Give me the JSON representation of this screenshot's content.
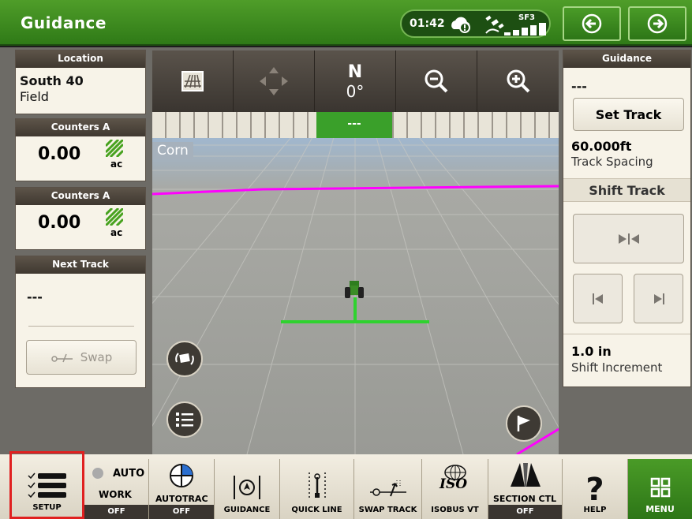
{
  "header": {
    "title": "Guidance",
    "time": "01:42",
    "signal_label": "SF3"
  },
  "location": {
    "header": "Location",
    "name": "South 40",
    "type": "Field"
  },
  "counters": [
    {
      "header": "Counters A",
      "value": "0.00",
      "unit": "ac"
    },
    {
      "header": "Counters A",
      "value": "0.00",
      "unit": "ac"
    }
  ],
  "next_track": {
    "header": "Next Track",
    "value": "---",
    "swap_label": "Swap"
  },
  "map": {
    "heading_letter": "N",
    "heading_degrees": "0°",
    "lightbar_value": "---",
    "crop_label": "Corn"
  },
  "guidance": {
    "header": "Guidance",
    "track_name": "---",
    "set_track_label": "Set Track",
    "track_spacing_value": "60.000ft",
    "track_spacing_label": "Track Spacing",
    "shift_track_label": "Shift Track",
    "shift_increment_value": "1.0 in",
    "shift_increment_label": "Shift Increment"
  },
  "bottom_bar": {
    "setup": "SETUP",
    "auto_label": "AUTO",
    "work_label": "WORK",
    "work_state": "OFF",
    "autotrac": "AUTOTRAC",
    "autotrac_state": "OFF",
    "guidance": "GUIDANCE",
    "quick_line": "QUICK LINE",
    "swap_track": "SWAP TRACK",
    "isobus_vt": "ISOBUS VT",
    "iso_text": "ISO",
    "section_ctl": "SECTION CTL",
    "section_state": "OFF",
    "help": "HELP",
    "menu": "MENU"
  },
  "colors": {
    "brand_green": "#367c2b",
    "highlight_red": "#e02020",
    "guidance_line": "#ff00ff",
    "active_green": "#2fd22f"
  }
}
